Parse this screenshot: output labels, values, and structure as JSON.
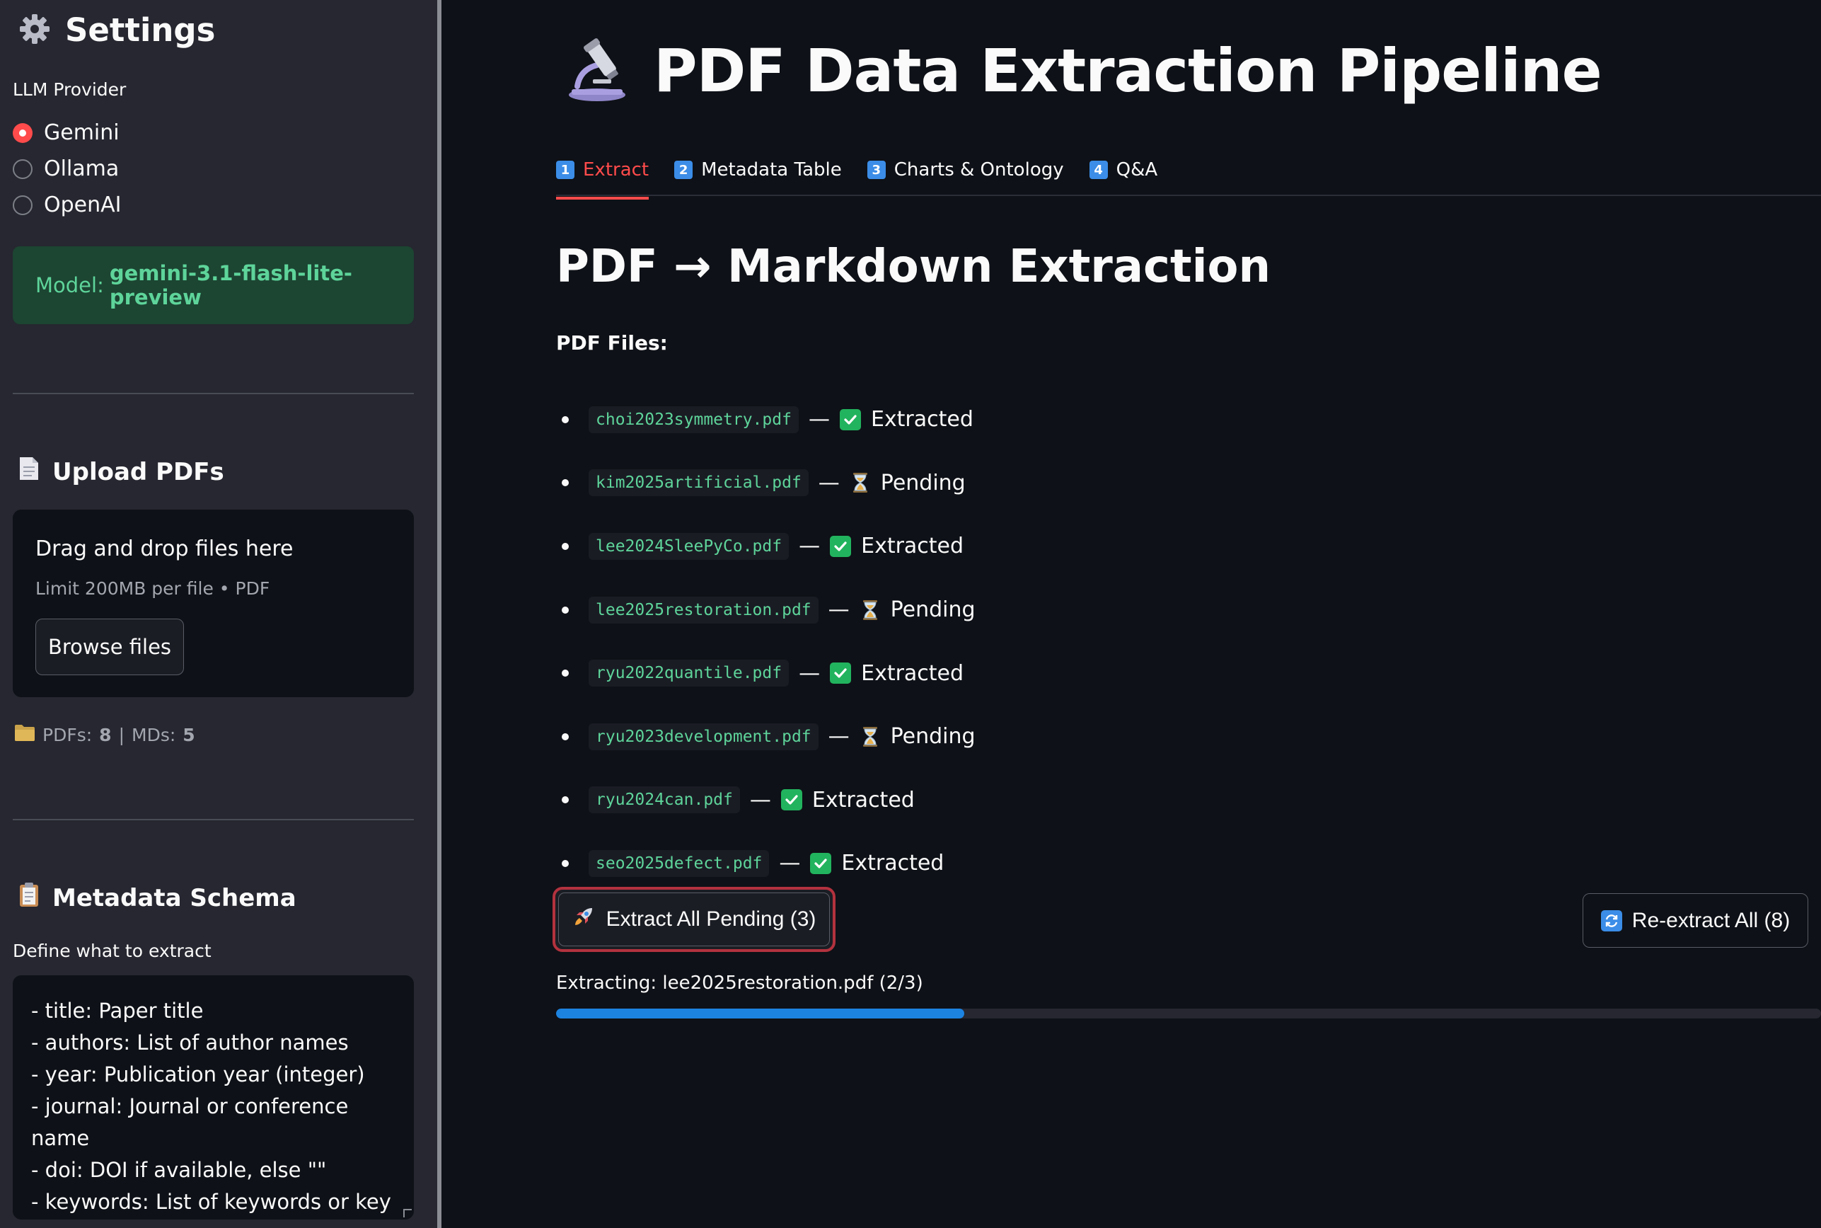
{
  "sidebar": {
    "title": "Settings",
    "title_icon": "gear-icon",
    "provider_label": "LLM Provider",
    "providers": [
      {
        "label": "Gemini",
        "selected": true
      },
      {
        "label": "Ollama",
        "selected": false
      },
      {
        "label": "OpenAI",
        "selected": false
      }
    ],
    "model_prefix": "Model:",
    "model_name": "gemini-3.1-flash-lite-preview",
    "upload": {
      "heading": "Upload PDFs",
      "icon": "document-icon",
      "drag_text": "Drag and drop files here",
      "limit_text": "Limit 200MB per file • PDF",
      "browse_label": "Browse files"
    },
    "counts": {
      "icon": "folder-icon",
      "pdfs_label": "PDFs:",
      "pdfs": "8",
      "separator": "|",
      "mds_label": "MDs:",
      "mds": "5"
    },
    "schema": {
      "heading": "Metadata Schema",
      "icon": "clipboard-icon",
      "label": "Define what to extract",
      "text": "- title: Paper title\n- authors: List of author names\n- year: Publication year (integer)\n- journal: Journal or conference name\n- doi: DOI if available, else \"\"\n- keywords: List of keywords or key phrases (extract from text if not"
    }
  },
  "header": {
    "title": "PDF Data Extraction Pipeline",
    "icon": "microscope-icon"
  },
  "tabs": [
    {
      "num": "1",
      "label": "Extract",
      "active": true
    },
    {
      "num": "2",
      "label": "Metadata Table",
      "active": false
    },
    {
      "num": "3",
      "label": "Charts & Ontology",
      "active": false
    },
    {
      "num": "4",
      "label": "Q&A",
      "active": false
    }
  ],
  "main": {
    "heading": "PDF → Markdown Extraction",
    "files_label": "PDF Files:",
    "files": [
      {
        "name": "choi2023symmetry.pdf",
        "status": "Extracted",
        "icon": "check-icon"
      },
      {
        "name": "kim2025artificial.pdf",
        "status": "Pending",
        "icon": "hourglass-icon"
      },
      {
        "name": "lee2024SleePyCo.pdf",
        "status": "Extracted",
        "icon": "check-icon"
      },
      {
        "name": "lee2025restoration.pdf",
        "status": "Pending",
        "icon": "hourglass-icon"
      },
      {
        "name": "ryu2022quantile.pdf",
        "status": "Extracted",
        "icon": "check-icon"
      },
      {
        "name": "ryu2023development.pdf",
        "status": "Pending",
        "icon": "hourglass-icon"
      },
      {
        "name": "ryu2024can.pdf",
        "status": "Extracted",
        "icon": "check-icon"
      },
      {
        "name": "seo2025defect.pdf",
        "status": "Extracted",
        "icon": "check-icon"
      }
    ],
    "extract_pending_label": "Extract All Pending (3)",
    "extract_pending_icon": "rocket-icon",
    "reextract_label": "Re-extract All (8)",
    "reextract_icon": "refresh-icon",
    "progress_text": "Extracting: lee2025restoration.pdf (2/3)",
    "progress_fraction": 0.3226
  },
  "colors": {
    "accent": "#ff4b4b",
    "sidebar_bg": "#262730",
    "main_bg": "#0e1117",
    "success_text": "#5ed49a",
    "progress": "#1c83e1"
  }
}
